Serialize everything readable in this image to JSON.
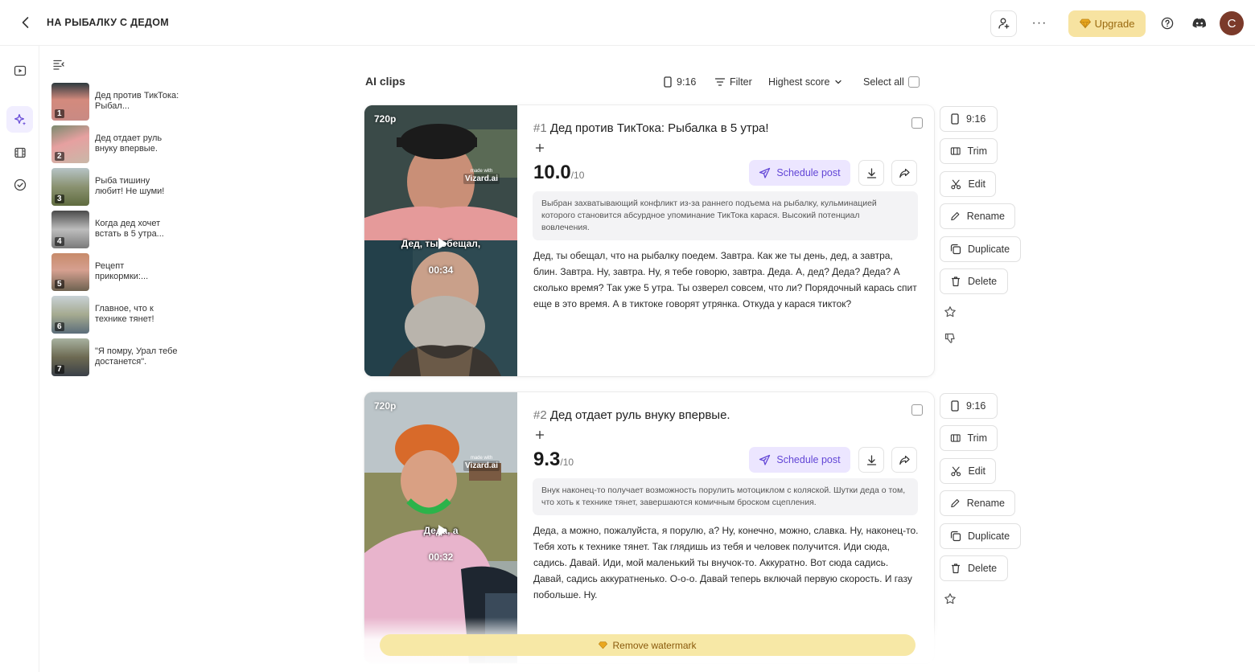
{
  "header": {
    "project_title": "НА РЫБАЛКУ С ДЕДОМ",
    "upgrade_label": "Upgrade",
    "avatar_initial": "C",
    "more_label": "···"
  },
  "sidebar": {
    "items": [
      {
        "num": "1",
        "label": "Дед против ТикТока: Рыбал..."
      },
      {
        "num": "2",
        "label": "Дед отдает руль внуку впервые."
      },
      {
        "num": "3",
        "label": "Рыба тишину любит! Не шуми!"
      },
      {
        "num": "4",
        "label": "Когда дед хочет встать в 5 утра..."
      },
      {
        "num": "5",
        "label": "Рецепт прикормки:..."
      },
      {
        "num": "6",
        "label": "Главное, что к технике тянет!"
      },
      {
        "num": "7",
        "label": "\"Я помру, Урал тебе достанется\"."
      }
    ]
  },
  "main": {
    "title": "AI clips",
    "aspect_label": "9:16",
    "filter_label": "Filter",
    "sort_label": "Highest score",
    "select_all_label": "Select all"
  },
  "clips": [
    {
      "resolution": "720p",
      "wm_small": "made with",
      "wm_brand": "Vizard.ai",
      "caption": "Дед, ты обещал,",
      "duration": "00:34",
      "idx": "#1",
      "title": "Дед против ТикТока: Рыбалка в 5 утра!",
      "score": "10.0",
      "score_outof": "/10",
      "schedule_label": "Schedule post",
      "reason": "Выбран захватывающий конфликт из-за раннего подъема на рыбалку, кульминацией которого становится абсурдное упоминание ТикТока карася. Высокий потенциал вовлечения.",
      "transcript": "Дед, ты обещал, что на рыбалку поедем. Завтра. Как же ты день, дед, а завтра, блин. Завтра. Ну, завтра. Ну, я тебе говорю, завтра. Деда. А, дед? Деда? Деда? А сколько время? Так уже 5 утра. Ты озверел совсем, что ли? Порядочный карась спит еще в это время. А в тиктоке говорят утрянка. Откуда у карася тикток?"
    },
    {
      "resolution": "720p",
      "wm_small": "made with",
      "wm_brand": "Vizard.ai",
      "caption": "Деда, а",
      "duration": "00:32",
      "idx": "#2",
      "title": "Дед отдает руль внуку впервые.",
      "score": "9.3",
      "score_outof": "/10",
      "schedule_label": "Schedule post",
      "reason": "Внук наконец-то получает возможность порулить мотоциклом с коляской. Шутки деда о том, что хоть к технике тянет, завершаются комичным броском сцепления.",
      "transcript": "Деда, а можно, пожалуйста, я порулю, а? Ну, конечно, можно, славка. Ну, наконец-то. Тебя хоть к технике тянет. Так глядишь из тебя и человек получится. Иди сюда, садись. Давай. Иди, мой маленький ты внучок-то. Аккуратно. Вот сюда садись. Давай, садись аккуратненько. О-о-о. Давай теперь включай первую скорость. И газу побольше. Ну."
    }
  ],
  "actions": {
    "aspect": "9:16",
    "trim": "Trim",
    "edit": "Edit",
    "rename": "Rename",
    "duplicate": "Duplicate",
    "delete": "Delete"
  },
  "watermark_bar": {
    "label": "Remove watermark"
  },
  "colors": {
    "accent": "#6246d6",
    "accent_bg": "#ece6ff",
    "upgrade_bg": "#f7e3a1",
    "watermark_bg": "#f7e8a6"
  }
}
